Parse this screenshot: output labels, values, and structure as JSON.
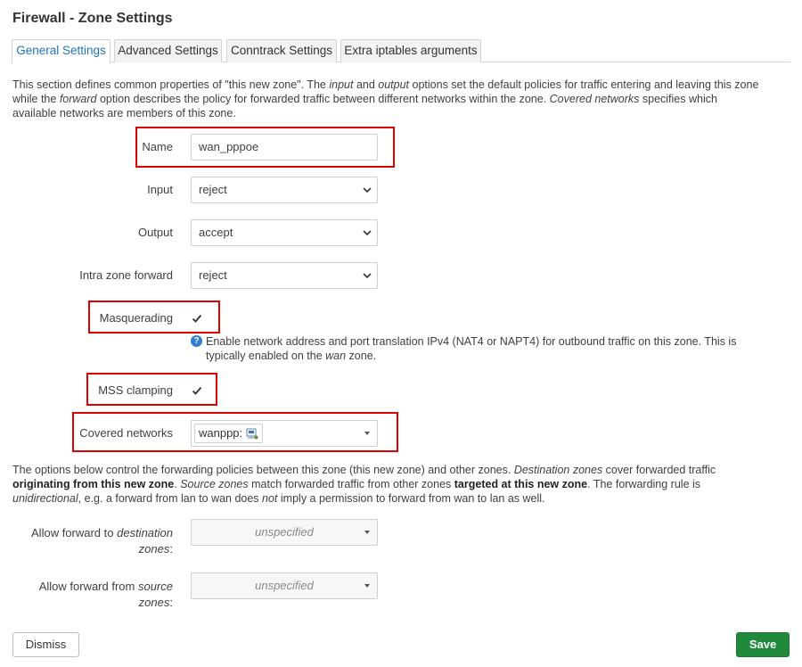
{
  "dialog": {
    "title": "Firewall - Zone Settings"
  },
  "tabs": [
    {
      "label": "General Settings",
      "active": true
    },
    {
      "label": "Advanced Settings",
      "active": false
    },
    {
      "label": "Conntrack Settings",
      "active": false
    },
    {
      "label": "Extra iptables arguments",
      "active": false
    }
  ],
  "intro": {
    "p1": "This section defines common properties of \"this new zone\". The ",
    "e1": "input",
    "p2": " and ",
    "e2": "output",
    "p3": " options set the default policies for traffic entering and leaving this zone",
    "p4": "while the ",
    "e3": "forward",
    "p5": " option describes the policy for forwarded traffic between different networks within the zone. ",
    "e4": "Covered networks",
    "p6": " specifies which",
    "p7": "available networks are members of this zone."
  },
  "fields": {
    "name": {
      "label": "Name",
      "value": "wan_pppoe"
    },
    "input": {
      "label": "Input",
      "value": "reject"
    },
    "output": {
      "label": "Output",
      "value": "accept"
    },
    "intra": {
      "label": "Intra zone forward",
      "value": "reject"
    },
    "masq": {
      "label": "Masquerading",
      "checked": true
    },
    "masq_help": {
      "a": "Enable network address and port translation IPv4 (NAT4 or NAPT4) for outbound traffic on this zone. This is",
      "b": "typically enabled on the ",
      "c": "wan",
      "d": " zone."
    },
    "mss": {
      "label": "MSS clamping",
      "checked": true
    },
    "covered": {
      "label": "Covered networks",
      "chip": "wanppp:",
      "icon": "network-interface-icon"
    }
  },
  "forward_desc": {
    "l1a": "The options below control the forwarding policies between this zone (this new zone) and other zones. ",
    "l1b": "Destination zones",
    "l1c": " cover forwarded traffic",
    "l2a": "originating from this new zone",
    "l2b": ". ",
    "l2c": "Source zones",
    "l2d": " match forwarded traffic from other zones ",
    "l2e": "targeted at this new zone",
    "l2f": ". The forwarding rule is",
    "l3a": "unidirectional",
    "l3b": ", e.g. a forward from lan to wan does ",
    "l3c": "not",
    "l3d": " imply a permission to forward from wan to lan as well."
  },
  "forward_fields": {
    "dest": {
      "label_a": "Allow forward to ",
      "label_b": "destination",
      "label_c": "zones",
      "label_d": ":",
      "value": "unspecified"
    },
    "src": {
      "label_a": "Allow forward from ",
      "label_b": "source",
      "label_c": "zones",
      "label_d": ":",
      "value": "unspecified"
    }
  },
  "buttons": {
    "dismiss": "Dismiss",
    "save": "Save"
  },
  "colors": {
    "highlight": "#e00000",
    "accent": "#1f74c0",
    "save": "#1f8a3b"
  }
}
